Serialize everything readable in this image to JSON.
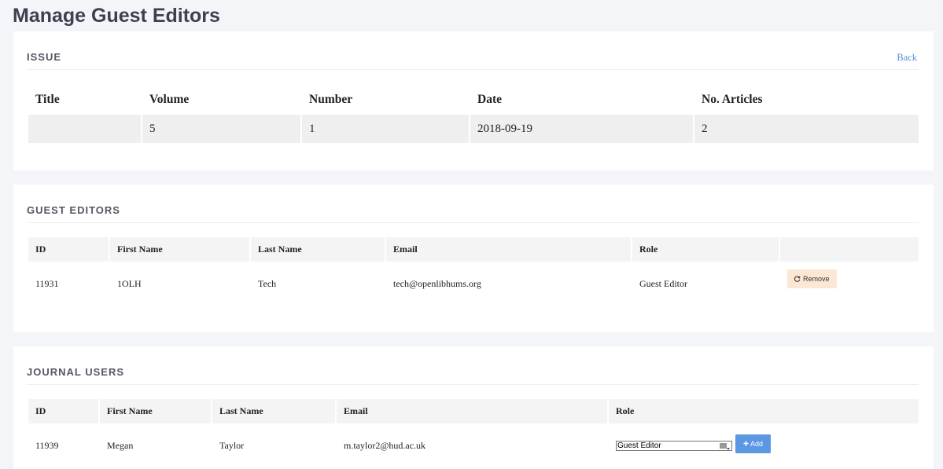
{
  "page": {
    "title": "Manage Guest Editors"
  },
  "issue": {
    "heading": "ISSUE",
    "back_label": "Back",
    "columns": [
      "Title",
      "Volume",
      "Number",
      "Date",
      "No. Articles"
    ],
    "row": {
      "title": "",
      "volume": "5",
      "number": "1",
      "date": "2018-09-19",
      "articles": "2"
    }
  },
  "guest_editors": {
    "heading": "GUEST EDITORS",
    "columns": [
      "ID",
      "First Name",
      "Last Name",
      "Email",
      "Role",
      ""
    ],
    "rows": [
      {
        "id": "11931",
        "first": "1OLH",
        "last": "Tech",
        "email": "tech@openlibhums.org",
        "role": "Guest Editor",
        "action": "Remove"
      }
    ]
  },
  "journal_users": {
    "heading": "JOURNAL USERS",
    "columns": [
      "ID",
      "First Name",
      "Last Name",
      "Email",
      "Role"
    ],
    "rows": [
      {
        "id": "11939",
        "first": "Megan",
        "last": "Taylor",
        "email": "m.taylor2@hud.ac.uk",
        "role_value": "Guest Editor",
        "action": "Add"
      }
    ]
  },
  "icons": {
    "remove": "refresh-icon",
    "add": "plus-icon",
    "select": "dropdown-arrow-icon"
  },
  "colors": {
    "add_button": "#5b97e3",
    "remove_button": "#fbe7d3",
    "link": "#5b92d6"
  }
}
